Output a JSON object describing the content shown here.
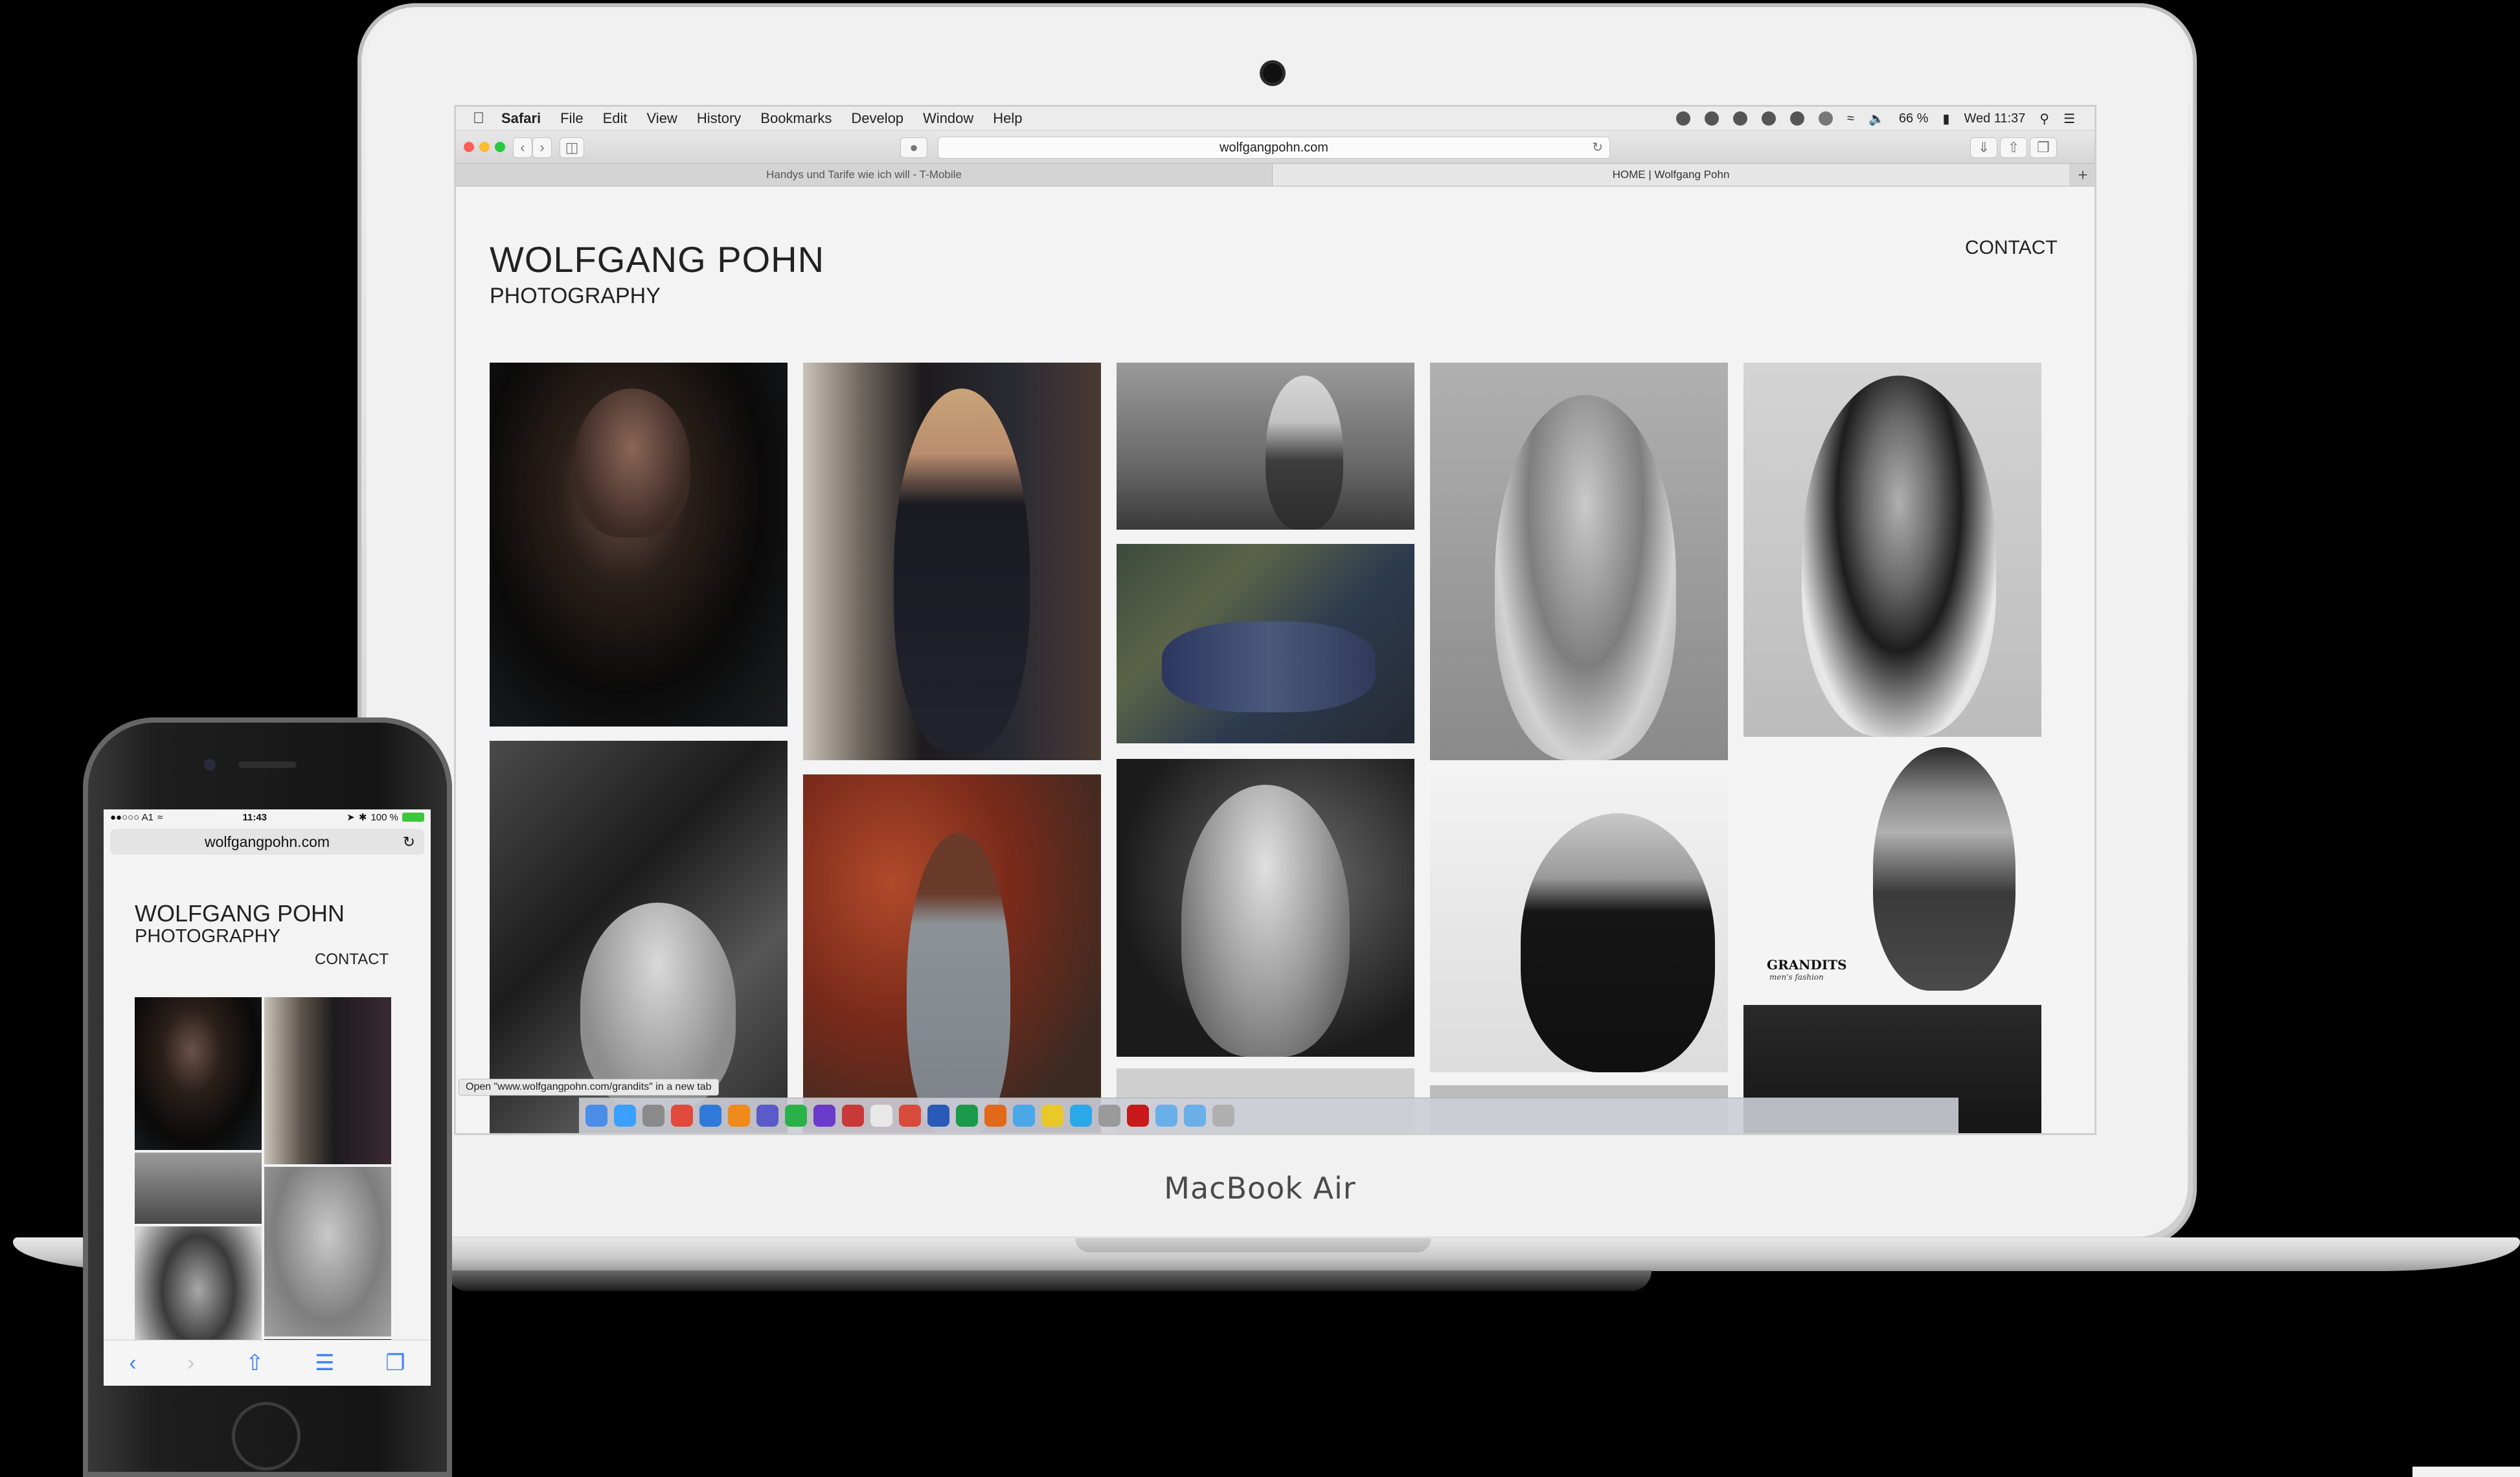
{
  "laptop": {
    "brand": "MacBook Air",
    "menubar": {
      "items": [
        "Safari",
        "File",
        "Edit",
        "View",
        "History",
        "Bookmarks",
        "Develop",
        "Window",
        "Help"
      ],
      "battery": "66 %",
      "clock": "Wed 11:37"
    },
    "browser": {
      "url": "wolfgangpohn.com",
      "tabs": [
        "Handys und Tarife wie ich will - T-Mobile",
        "HOME | Wolfgang Pohn"
      ],
      "status_link": "Open \"www.wolfgangpohn.com/grandits\" in a new tab"
    },
    "site": {
      "title": "WOLFGANG POHN",
      "subtitle": "PHOTOGRAPHY",
      "contact": "CONTACT",
      "grandits_label": "GRANDITS",
      "grandits_tagline": "men's fashion"
    }
  },
  "phone": {
    "carrier": "●●○○○ A1",
    "time": "11:43",
    "battery": "100 %",
    "url": "wolfgangpohn.com",
    "site": {
      "title": "WOLFGANG POHN",
      "subtitle": "PHOTOGRAPHY",
      "contact": "CONTACT"
    }
  }
}
